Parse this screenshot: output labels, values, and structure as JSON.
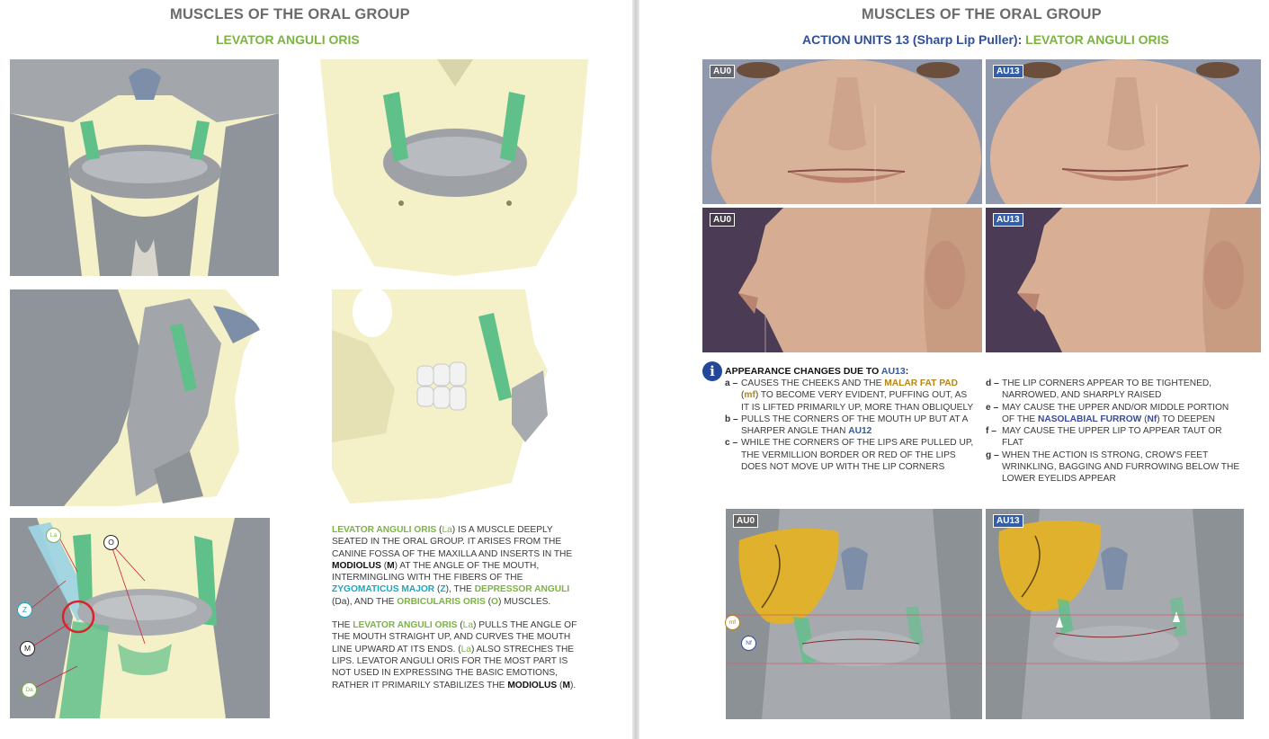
{
  "left_page": {
    "title": "MUSCLES OF THE ORAL GROUP",
    "subtitle": "LEVATOR ANGULI ORIS",
    "figure_labels": {
      "la": "La",
      "o": "O",
      "z": "Z",
      "m": "M",
      "da": "Da"
    },
    "description": {
      "p1": [
        {
          "text": "LEVATOR ANGULI ORIS",
          "style": "gb"
        },
        {
          "text": " (",
          "style": ""
        },
        {
          "text": "La",
          "style": "green"
        },
        {
          "text": ") IS A MUSCLE DEEPLY SEATED IN THE ORAL GROUP. IT ARISES FROM THE CANINE FOSSA OF THE MAXILLA AND INSERTS IN THE ",
          "style": ""
        },
        {
          "text": "MODIOLUS",
          "style": "bk"
        },
        {
          "text": " (",
          "style": ""
        },
        {
          "text": "M",
          "style": "bk"
        },
        {
          "text": ") AT THE ANGLE OF THE MOUTH, INTERMINGLING WITH THE FIBERS OF THE ",
          "style": ""
        },
        {
          "text": "ZYGOMATICUS MAJOR",
          "style": "cy"
        },
        {
          "text": " (",
          "style": ""
        },
        {
          "text": "Z",
          "style": "cy"
        },
        {
          "text": "), THE ",
          "style": ""
        },
        {
          "text": "DEPRESSOR ANGULI",
          "style": "gb"
        },
        {
          "text": " (Da), AND THE ",
          "style": ""
        },
        {
          "text": "ORBICULARIS ORIS",
          "style": "gb"
        },
        {
          "text": " (",
          "style": ""
        },
        {
          "text": "O",
          "style": "gb"
        },
        {
          "text": ") MUSCLES.",
          "style": ""
        }
      ],
      "p2": [
        {
          "text": "THE ",
          "style": ""
        },
        {
          "text": "LEVATOR ANGULI ORIS",
          "style": "gb"
        },
        {
          "text": " (",
          "style": ""
        },
        {
          "text": "La",
          "style": "green"
        },
        {
          "text": ") PULLS THE ANGLE OF THE MOUTH STRAIGHT UP, AND CURVES THE MOUTH LINE UPWARD AT ITS ENDS. (",
          "style": ""
        },
        {
          "text": "La",
          "style": "green"
        },
        {
          "text": ") ALSO STRECHES THE LIPS. LEVATOR ANGULI ORIS FOR THE MOST PART IS NOT USED IN EXPRESSING THE BASIC EMOTIONS, RATHER IT PRIMARILY STABILIZES THE ",
          "style": ""
        },
        {
          "text": "MODIOLUS",
          "style": "bk"
        },
        {
          "text": " (",
          "style": ""
        },
        {
          "text": "M",
          "style": "bk"
        },
        {
          "text": ").",
          "style": ""
        }
      ]
    }
  },
  "right_page": {
    "title": "MUSCLES OF THE ORAL GROUP",
    "subtitle": {
      "prefix": "ACTION UNITS ",
      "number": "13",
      "paren": " (Sharp Lip Puller): ",
      "muscle": "LEVATOR ANGULI ORIS"
    },
    "photo_tags": {
      "neutral": "AU0",
      "action": "AU13"
    },
    "appearance": {
      "icon": "i",
      "heading_prefix": "APPEARANCE CHANGES DUE TO ",
      "heading_au": "AU13",
      "heading_suffix": ":",
      "left_items": [
        {
          "key": "a –",
          "parts": [
            {
              "text": "CAUSES THE CHEEKS AND THE ",
              "style": ""
            },
            {
              "text": "MALAR FAT PAD",
              "style": "gold"
            },
            {
              "text": " (",
              "style": ""
            },
            {
              "text": "mf",
              "style": "gold"
            },
            {
              "text": ") TO BECOME VERY EVIDENT, PUFFING OUT, AS IT IS LIFTED PRIMARILY UP, MORE THAN OBLIQUELY",
              "style": ""
            }
          ]
        },
        {
          "key": "b –",
          "parts": [
            {
              "text": "PULLS THE CORNERS OF THE MOUTH UP BUT AT A SHARPER ANGLE THAN ",
              "style": ""
            },
            {
              "text": "AU12",
              "style": "au"
            }
          ]
        },
        {
          "key": "c –",
          "parts": [
            {
              "text": "WHILE THE CORNERS OF THE LIPS ARE PULLED UP, THE VERMILLION BORDER OR RED OF THE LIPS DOES NOT MOVE UP WITH THE LIP CORNERS",
              "style": ""
            }
          ]
        }
      ],
      "right_items": [
        {
          "key": "d –",
          "parts": [
            {
              "text": "THE LIP CORNERS APPEAR TO BE TIGHTENED, NARROWED, AND SHARPLY RAISED",
              "style": ""
            }
          ]
        },
        {
          "key": "e –",
          "parts": [
            {
              "text": "MAY CAUSE THE UPPER AND/OR MIDDLE PORTION OF THE ",
              "style": ""
            },
            {
              "text": "NASOLABIAL FURROW",
              "style": "nav"
            },
            {
              "text": " (",
              "style": ""
            },
            {
              "text": "Nf",
              "style": "nav"
            },
            {
              "text": ") TO DEEPEN",
              "style": ""
            }
          ]
        },
        {
          "key": "f –",
          "parts": [
            {
              "text": "MAY CAUSE THE UPPER LIP TO APPEAR TAUT OR FLAT",
              "style": ""
            }
          ]
        },
        {
          "key": "g –",
          "parts": [
            {
              "text": "WHEN THE ACTION IS STRONG, CROW'S FEET WRINKLING, BAGGING AND FURROWING BELOW THE LOWER EYELIDS APPEAR",
              "style": ""
            }
          ]
        }
      ]
    },
    "bottom_labels": {
      "mf": "mf",
      "nf": "Nf"
    }
  },
  "colors": {
    "title_gray": "#6b6b6b",
    "muscle_green": "#7cb342",
    "navy": "#2f4f9b",
    "cyan": "#19a7c2",
    "bone": "#f4f0c7",
    "muscle_gray": "#8f949a",
    "fat_gold": "#e0b12c"
  }
}
